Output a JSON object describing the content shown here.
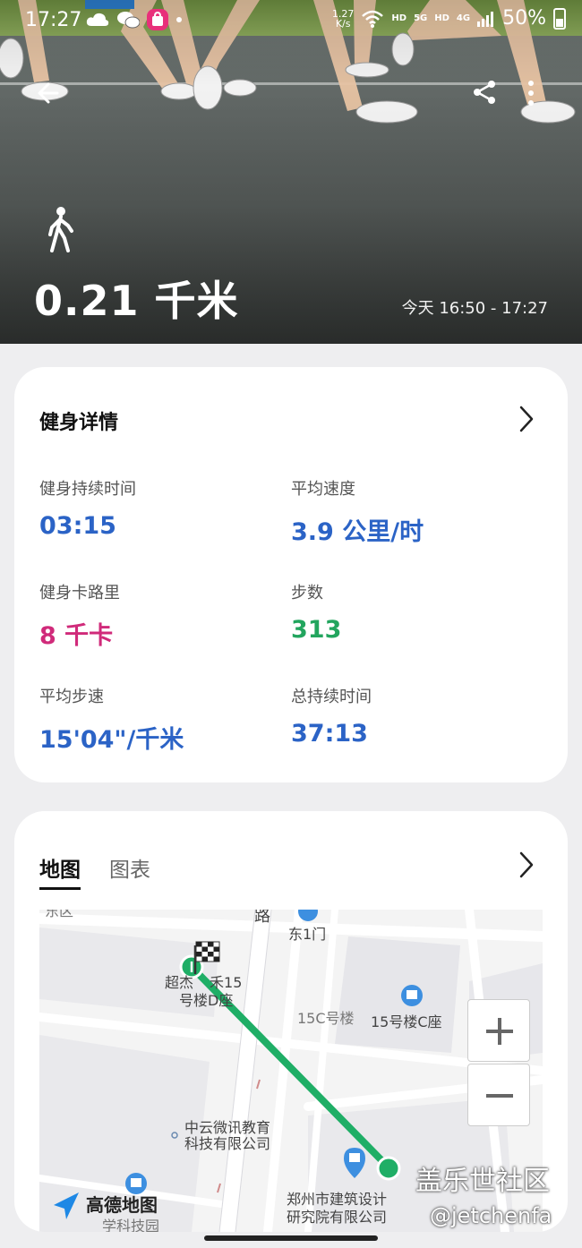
{
  "status_bar": {
    "time": "17:27",
    "network_speed_value": "1.27",
    "network_speed_unit": "K/s",
    "hd1": "HD",
    "sig5g": "5G",
    "hd2": "HD",
    "sig4g": "4G",
    "battery": "50%",
    "icons": [
      "cloud-icon",
      "wechat-icon",
      "shopping-bag-icon",
      "dot-icon",
      "wifi-icon",
      "signal-icon",
      "battery-icon"
    ]
  },
  "hero": {
    "activity_icon": "walking-icon",
    "distance": "0.21 千米",
    "time_range": "今天 16:50 - 17:27"
  },
  "details": {
    "title": "健身详情",
    "stats": [
      {
        "label": "健身持续时间",
        "value": "03:15",
        "color": "#2b63c6"
      },
      {
        "label": "平均速度",
        "value": "3.9 公里/时",
        "color": "#2b63c6"
      },
      {
        "label": "健身卡路里",
        "value": "8 千卡",
        "color": "#d02a7a"
      },
      {
        "label": "步数",
        "value": "313",
        "color": "#22a55e"
      },
      {
        "label": "平均步速",
        "value": "15'04\"/千米",
        "color": "#2b63c6"
      },
      {
        "label": "总持续时间",
        "value": "37:13",
        "color": "#2b63c6"
      }
    ]
  },
  "map_card": {
    "tabs": [
      "地图",
      "图表"
    ],
    "active_tab": 0,
    "labels": {
      "top_left": "东区",
      "road": "路",
      "gate": "东1门",
      "poi1_line1": "超杰",
      "poi1_line1b": "禾15",
      "poi1_line2": "号楼D座",
      "building_15c": "15C号楼",
      "building_15c_seat": "15号楼C座",
      "company1_line1": "中云微讯教育",
      "company1_line2": "科技有限公司",
      "company2_line1": "郑州市建筑设计",
      "company2_line2": "研究院有限公司",
      "bottom_left": "学科技园",
      "logo": "高德地图"
    },
    "zoom_in": "+",
    "zoom_out": "−",
    "route_color": "#1fae66"
  },
  "watermark": {
    "line1": "盖乐世社区",
    "line2": "@jetchenfa"
  }
}
